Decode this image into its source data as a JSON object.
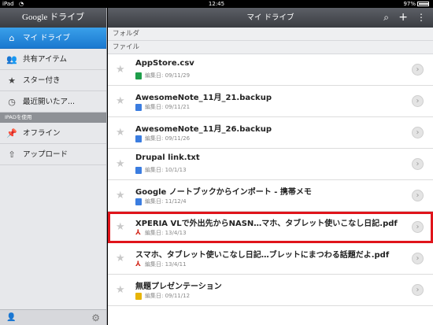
{
  "status": {
    "carrier": "iPad",
    "time": "12:45",
    "battery": "97%",
    "battery_level": 0.97
  },
  "sidebar": {
    "logo": "Google ドライブ",
    "items": [
      {
        "label": "マイ ドライブ",
        "icon": "drive-icon"
      },
      {
        "label": "共有アイテム",
        "icon": "shared-people-icon"
      },
      {
        "label": "スター付き",
        "icon": "star-icon"
      },
      {
        "label": "最近開いたア...",
        "icon": "clock-icon"
      }
    ],
    "section_label": "IPADを使用",
    "device_items": [
      {
        "label": "オフライン",
        "icon": "pin-icon"
      },
      {
        "label": "アップロード",
        "icon": "upload-icon"
      }
    ]
  },
  "main": {
    "title": "マイ ドライブ",
    "folder_section": "フォルダ",
    "file_section": "ファイル",
    "files": [
      {
        "name": "AppStore.csv",
        "date": "編集日: 09/11/29",
        "type": "sheet"
      },
      {
        "name": "AwesomeNote_11月_21.backup",
        "date": "編集日: 09/11/21",
        "type": "doc"
      },
      {
        "name": "AwesomeNote_11月_26.backup",
        "date": "編集日: 09/11/26",
        "type": "doc"
      },
      {
        "name": "Drupal link.txt",
        "date": "編集日: 10/1/13",
        "type": "doc"
      },
      {
        "name": "Google ノートブックからインポート - 携帯メモ",
        "date": "編集日: 11/12/4",
        "type": "doc"
      },
      {
        "name": "XPERIA VLで外出先からNASN…マホ、タブレット使いこなし日記.pdf",
        "date": "編集日: 13/4/13",
        "type": "pdf"
      },
      {
        "name": "スマホ、タブレット使いこなし日記…ブレットにまつわる話題だよ.pdf",
        "date": "編集日: 13/4/11",
        "type": "pdf"
      },
      {
        "name": "無題プレゼンテーション",
        "date": "編集日: 09/11/12",
        "type": "slide"
      }
    ]
  },
  "colors": {
    "highlight": "#e0141b",
    "active_blue": "#1a78d0"
  }
}
